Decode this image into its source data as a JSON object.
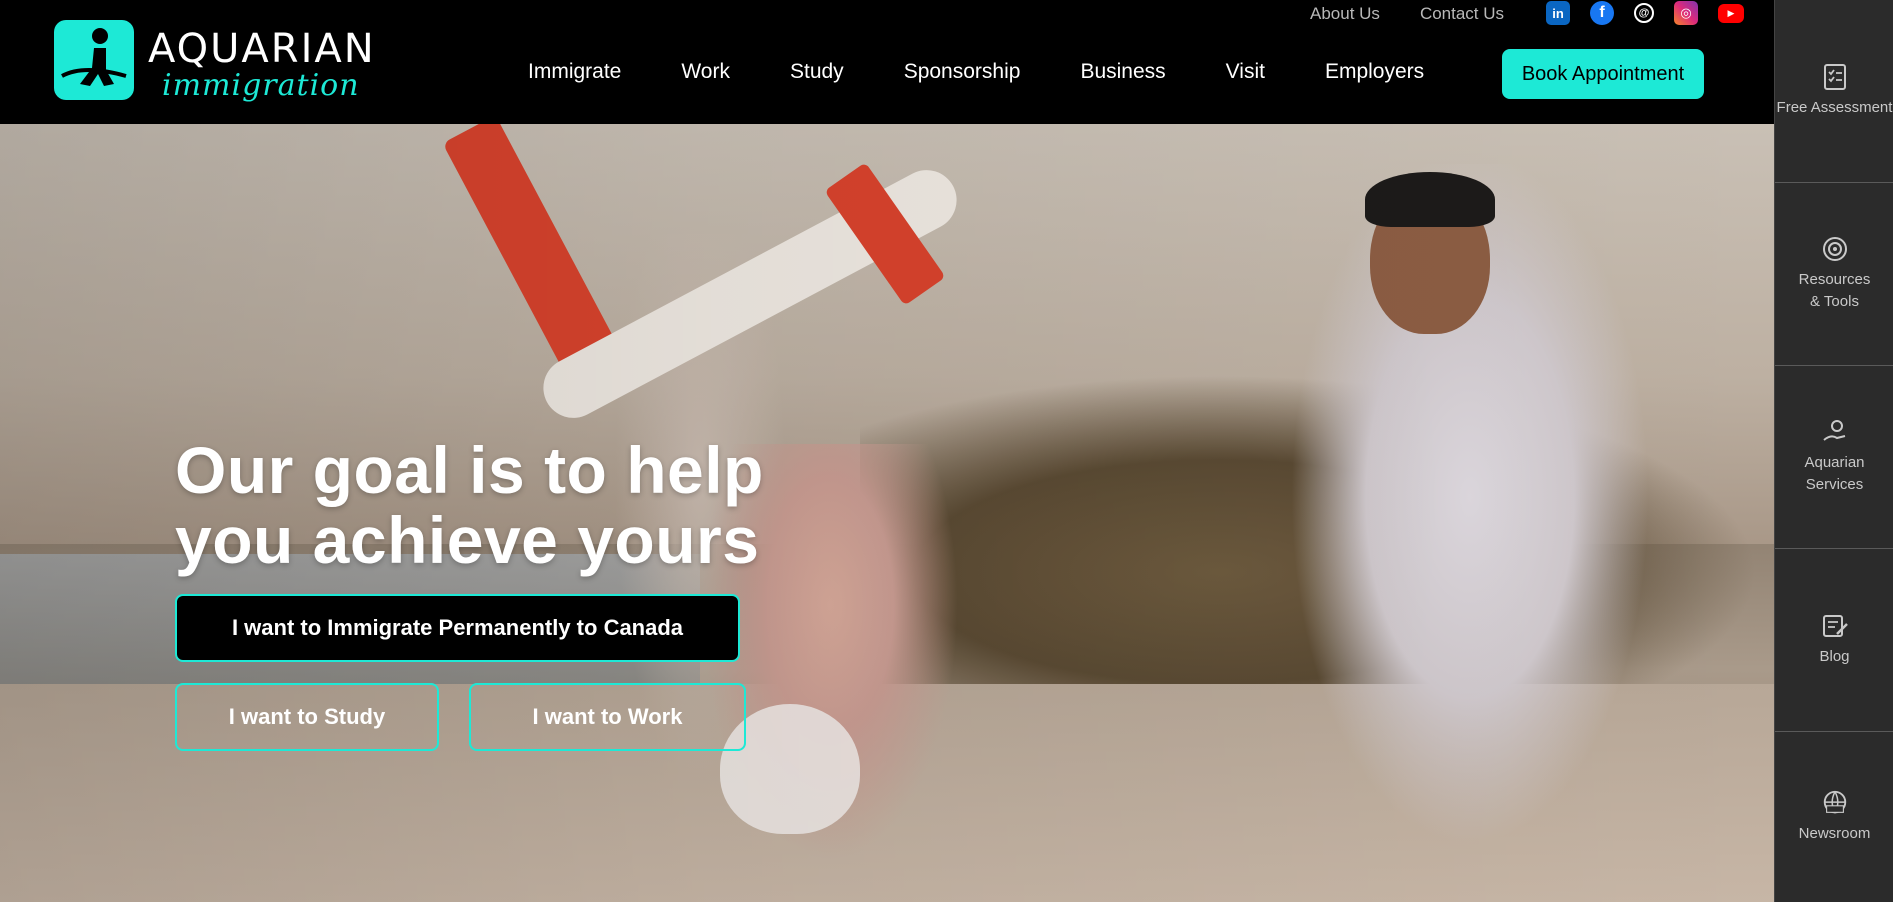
{
  "header": {
    "logo": {
      "word": "AQUARIAN",
      "script": "immigration"
    },
    "top_links": [
      "About Us",
      "Contact Us"
    ],
    "socials": [
      {
        "name": "linkedin-icon",
        "glyph": "in"
      },
      {
        "name": "facebook-icon",
        "glyph": "f"
      },
      {
        "name": "threads-icon",
        "glyph": "@"
      },
      {
        "name": "instagram-icon",
        "glyph": "◎"
      },
      {
        "name": "youtube-icon",
        "glyph": "▶"
      }
    ],
    "nav": [
      "Immigrate",
      "Work",
      "Study",
      "Sponsorship",
      "Business",
      "Visit",
      "Employers"
    ],
    "book_label": "Book Appointment"
  },
  "hero": {
    "headline_line1": "Our goal is to help",
    "headline_line2": "you achieve yours",
    "cta_primary": "I want to Immigrate Permanently to Canada",
    "cta_study": "I want to Study",
    "cta_work": "I want to Work"
  },
  "sidebar": {
    "items": [
      {
        "label": "Free Assessment",
        "icon": "checklist-icon"
      },
      {
        "label": "Resources & Tools",
        "icon": "target-icon"
      },
      {
        "label": "Aquarian Services",
        "icon": "hand-gear-icon"
      },
      {
        "label": "Blog",
        "icon": "edit-note-icon"
      },
      {
        "label": "Newsroom",
        "icon": "globe-news-icon"
      }
    ]
  },
  "colors": {
    "accent": "#1de9d6",
    "header_bg": "#000000",
    "sidebar_bg": "#2b2b2b"
  }
}
